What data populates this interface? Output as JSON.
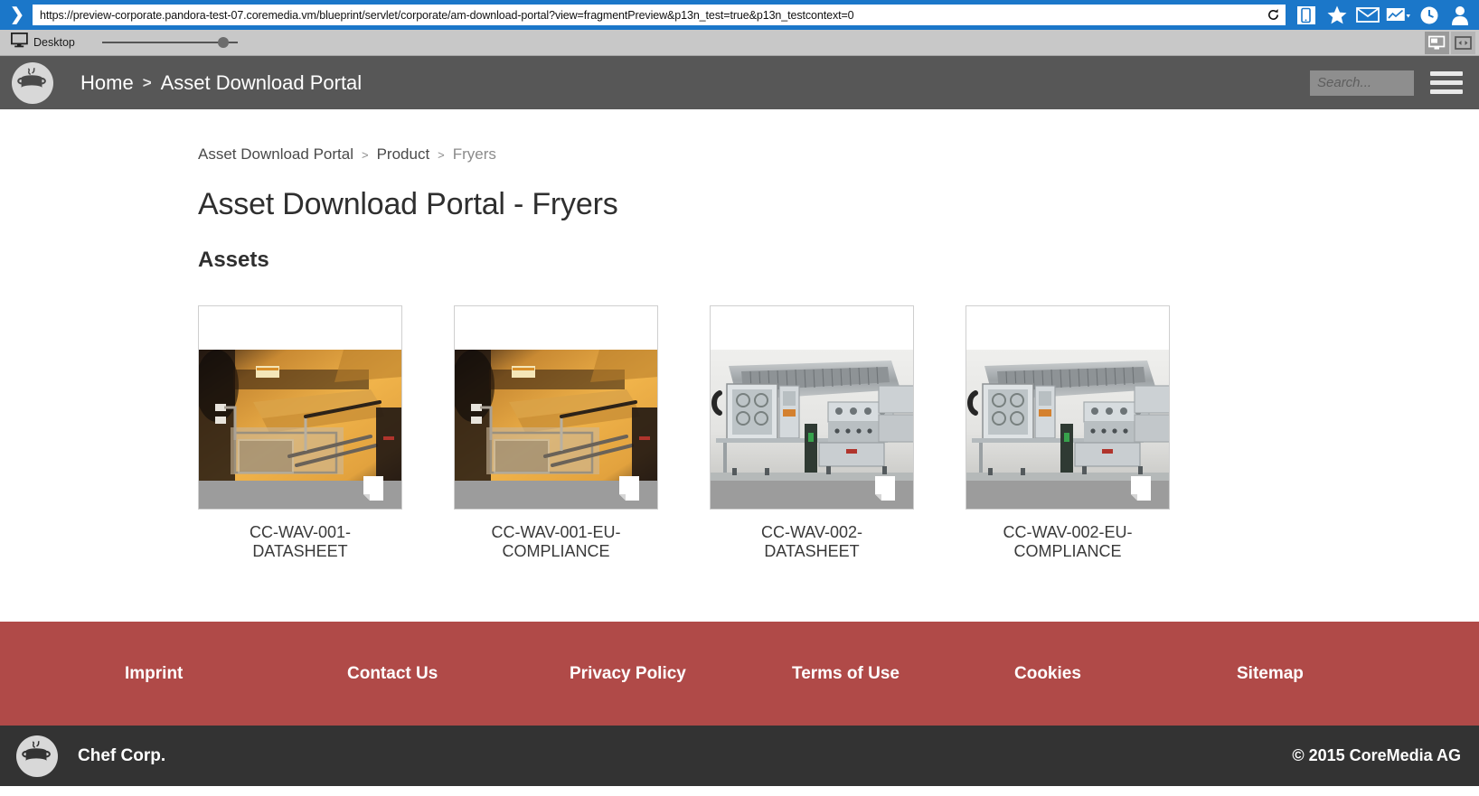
{
  "browser": {
    "url": "https://preview-corporate.pandora-test-07.coremedia.vm/blueprint/servlet/corporate/am-download-portal?view=fragmentPreview&p13n_test=true&p13n_testcontext=0",
    "chevron_label": "❯",
    "icons": [
      {
        "name": "reload-icon",
        "glyph": "⟳"
      },
      {
        "name": "mobile-preview-icon",
        "glyph": ""
      },
      {
        "name": "favorite-star-icon",
        "glyph": "★"
      },
      {
        "name": "mail-icon",
        "glyph": "✉"
      },
      {
        "name": "analytics-chart-icon",
        "glyph": ""
      },
      {
        "name": "history-clock-icon",
        "glyph": ""
      },
      {
        "name": "user-account-icon",
        "glyph": ""
      }
    ],
    "accent_color": "#1b77c9"
  },
  "preview_toolbar": {
    "device_label": "Desktop",
    "zoom_slider_value": 85,
    "buttons": [
      {
        "name": "desktop-view-button",
        "active": true
      },
      {
        "name": "responsive-view-button",
        "active": false
      }
    ]
  },
  "site_header": {
    "logo_name": "chef-corp-pot-logo",
    "breadcrumb": [
      {
        "label": "Home",
        "current": false
      },
      {
        "label": "Asset Download Portal",
        "current": true
      }
    ],
    "separator": ">",
    "search": {
      "placeholder": "Search...",
      "value": ""
    },
    "background_color": "#575757"
  },
  "main": {
    "breadcrumb": [
      {
        "label": "Asset Download Portal",
        "current": false
      },
      {
        "label": "Product",
        "current": false
      },
      {
        "label": "Fryers",
        "current": true
      }
    ],
    "separator": ">",
    "title": "Asset Download Portal - Fryers",
    "section_title": "Assets",
    "assets": [
      {
        "label": "CC-WAV-001-\nDATASHEET",
        "image": "deep-fryer-golden",
        "icon": "document-icon"
      },
      {
        "label": "CC-WAV-001-EU-\nCOMPLIANCE",
        "image": "deep-fryer-golden",
        "icon": "document-icon"
      },
      {
        "label": "CC-WAV-002-\nDATASHEET",
        "image": "commercial-kitchen-steel",
        "icon": "document-icon"
      },
      {
        "label": "CC-WAV-002-EU-\nCOMPLIANCE",
        "image": "commercial-kitchen-steel",
        "icon": "document-icon"
      }
    ]
  },
  "footer": {
    "background_color": "#b04a48",
    "links": [
      "Imprint",
      "Contact Us",
      "Privacy Policy",
      "Terms of Use",
      "Cookies",
      "Sitemap"
    ],
    "brand_name": "Chef Corp.",
    "copyright": "© 2015 CoreMedia AG",
    "bottom_background_color": "#333333"
  }
}
